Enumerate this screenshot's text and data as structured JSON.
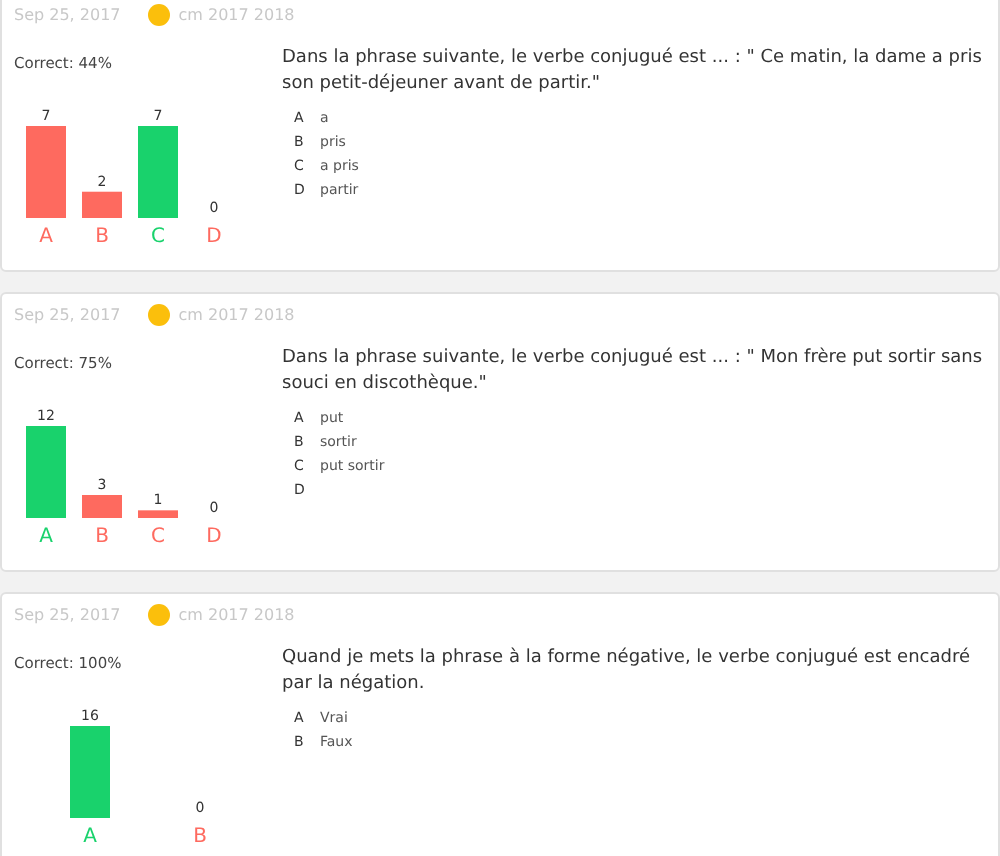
{
  "cards": [
    {
      "date": "Sep 25, 2017",
      "class_name": "cm 2017 2018",
      "correct": "Correct: 44%",
      "question": "Dans la phrase suivante, le verbe conjugué est ... : \" Ce matin, la dame a pris son petit-déjeuner avant de partir.\"",
      "options": [
        {
          "letter": "A",
          "text": "a"
        },
        {
          "letter": "B",
          "text": "pris"
        },
        {
          "letter": "C",
          "text": "a pris"
        },
        {
          "letter": "D",
          "text": "partir"
        }
      ],
      "answers": [
        {
          "correct": false
        },
        {
          "correct": false
        },
        {
          "correct": true
        },
        {
          "correct": false
        }
      ],
      "chart_data": {
        "type": "bar",
        "categories": [
          "A",
          "B",
          "C",
          "D"
        ],
        "values": [
          7,
          2,
          7,
          0
        ],
        "data_labels": true
      }
    },
    {
      "date": "Sep 25, 2017",
      "class_name": "cm 2017 2018",
      "correct": "Correct: 75%",
      "question": "Dans la phrase suivante, le verbe conjugué est ... : \" Mon frère put sortir sans souci en discothèque.\"",
      "options": [
        {
          "letter": "A",
          "text": "put"
        },
        {
          "letter": "B",
          "text": "sortir"
        },
        {
          "letter": "C",
          "text": "put sortir"
        },
        {
          "letter": "D"
        }
      ],
      "answers": [
        {
          "correct": true
        },
        {
          "correct": false
        },
        {
          "correct": false
        },
        {
          "correct": false
        }
      ],
      "chart_data": {
        "type": "bar",
        "categories": [
          "A",
          "B",
          "C",
          "D"
        ],
        "values": [
          12,
          3,
          1,
          0
        ],
        "data_labels": true
      }
    },
    {
      "date": "Sep 25, 2017",
      "class_name": "cm 2017 2018",
      "correct": "Correct: 100%",
      "question": "Quand je mets la phrase à la forme négative, le verbe conjugué est encadré par la négation.",
      "options": [
        {
          "letter": "A",
          "text": "Vrai"
        },
        {
          "letter": "B",
          "text": "Faux"
        }
      ],
      "answers": [
        {
          "correct": true
        },
        {
          "correct": false
        }
      ],
      "chart_data": {
        "type": "bar",
        "categories": [
          "A",
          "B"
        ],
        "values": [
          16,
          0
        ],
        "data_labels": true
      }
    }
  ]
}
